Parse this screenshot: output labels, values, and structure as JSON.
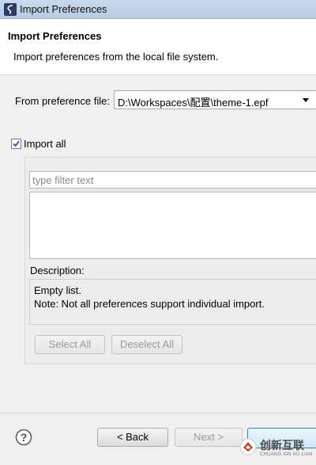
{
  "window": {
    "title": "Import Preferences"
  },
  "banner": {
    "title": "Import Preferences",
    "description": "Import preferences from the local file system."
  },
  "from_file": {
    "label": "From preference file:",
    "value": "D:\\Workspaces\\配置\\theme-1.epf"
  },
  "import_all": {
    "label": "Import all",
    "checked": true
  },
  "filter": {
    "placeholder": "type filter text",
    "value": ""
  },
  "description": {
    "label": "Description:",
    "lines": [
      "Empty list.",
      "Note: Not all preferences support individual import."
    ]
  },
  "selection_buttons": {
    "select_all": "Select All",
    "deselect_all": "Deselect All"
  },
  "footer": {
    "back": "< Back",
    "next": "Next >"
  },
  "watermark": {
    "text": "创新互联",
    "sub": "CHUANG XIN HU LIAN"
  },
  "colors": {
    "accent": "#3c7fb1",
    "check": "#1f5aa6"
  }
}
